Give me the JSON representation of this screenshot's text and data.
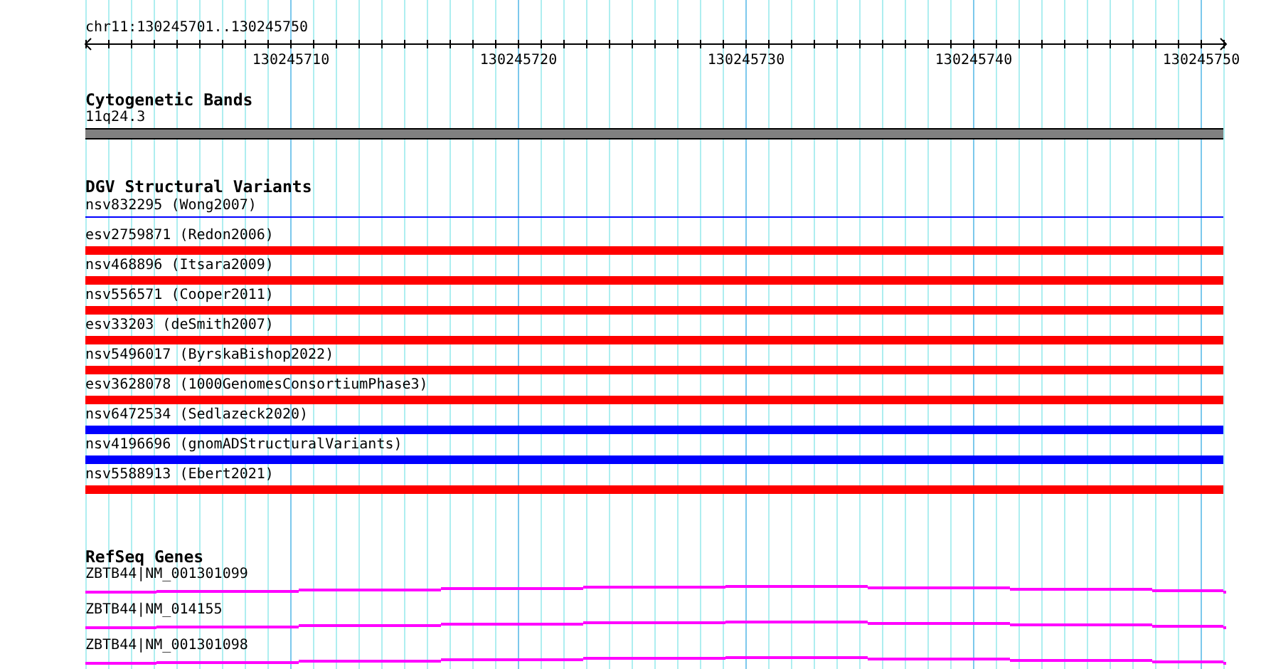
{
  "locus": "chr11:130245701..130245750",
  "ruler": {
    "ticks": [
      "130245710",
      "130245720",
      "130245730",
      "130245740",
      "130245750"
    ]
  },
  "tracks": [
    {
      "kind": "bands",
      "title": "Cytogenetic Bands",
      "features": [
        {
          "label": "11q24.3"
        }
      ]
    },
    {
      "kind": "variants",
      "title": "DGV Structural Variants",
      "features": [
        {
          "label": "nsv832295 (Wong2007)",
          "color": "#0000ff",
          "kind": "line"
        },
        {
          "label": "esv2759871 (Redon2006)",
          "color": "#ff0000",
          "kind": "bar"
        },
        {
          "label": "nsv468896 (Itsara2009)",
          "color": "#ff0000",
          "kind": "bar"
        },
        {
          "label": "nsv556571 (Cooper2011)",
          "color": "#ff0000",
          "kind": "bar"
        },
        {
          "label": "esv33203 (deSmith2007)",
          "color": "#ff0000",
          "kind": "bar"
        },
        {
          "label": "nsv5496017 (ByrskaBishop2022)",
          "color": "#ff0000",
          "kind": "bar"
        },
        {
          "label": "esv3628078 (1000GenomesConsortiumPhase3)",
          "color": "#ff0000",
          "kind": "bar"
        },
        {
          "label": "nsv6472534 (Sedlazeck2020)",
          "color": "#0000ff",
          "kind": "bar"
        },
        {
          "label": "nsv4196696 (gnomADStructuralVariants)",
          "color": "#0000ff",
          "kind": "bar"
        },
        {
          "label": "nsv5588913 (Ebert2021)",
          "color": "#ff0000",
          "kind": "bar"
        }
      ]
    },
    {
      "kind": "genes",
      "title": "RefSeq Genes",
      "features": [
        {
          "label": "ZBTB44|NM_001301099"
        },
        {
          "label": "ZBTB44|NM_014155"
        },
        {
          "label": "ZBTB44|NM_001301098"
        }
      ]
    }
  ]
}
